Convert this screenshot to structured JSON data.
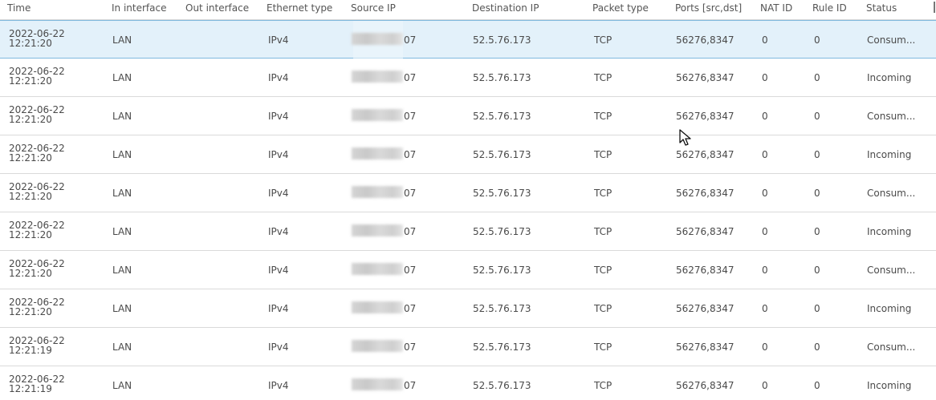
{
  "columns": {
    "time": "Time",
    "in_interface": "In interface",
    "out_interface": "Out interface",
    "ethernet_type": "Ethernet type",
    "source_ip": "Source IP",
    "destination_ip": "Destination IP",
    "packet_type": "Packet type",
    "ports": "Ports [src,dst]",
    "nat_id": "NAT ID",
    "rule_id": "Rule ID",
    "status": "Status"
  },
  "rows": [
    {
      "date": "2022-06-22",
      "clock": "12:21:20",
      "in": "LAN",
      "out": "",
      "eth": "IPv4",
      "src_tail": "07",
      "dst": "52.5.76.173",
      "ptype": "TCP",
      "ports": "56276,8347",
      "nat": "0",
      "rule": "0",
      "status": "Consum..."
    },
    {
      "date": "2022-06-22",
      "clock": "12:21:20",
      "in": "LAN",
      "out": "",
      "eth": "IPv4",
      "src_tail": "07",
      "dst": "52.5.76.173",
      "ptype": "TCP",
      "ports": "56276,8347",
      "nat": "0",
      "rule": "0",
      "status": "Incoming"
    },
    {
      "date": "2022-06-22",
      "clock": "12:21:20",
      "in": "LAN",
      "out": "",
      "eth": "IPv4",
      "src_tail": "07",
      "dst": "52.5.76.173",
      "ptype": "TCP",
      "ports": "56276,8347",
      "nat": "0",
      "rule": "0",
      "status": "Consum..."
    },
    {
      "date": "2022-06-22",
      "clock": "12:21:20",
      "in": "LAN",
      "out": "",
      "eth": "IPv4",
      "src_tail": "07",
      "dst": "52.5.76.173",
      "ptype": "TCP",
      "ports": "56276,8347",
      "nat": "0",
      "rule": "0",
      "status": "Incoming"
    },
    {
      "date": "2022-06-22",
      "clock": "12:21:20",
      "in": "LAN",
      "out": "",
      "eth": "IPv4",
      "src_tail": "07",
      "dst": "52.5.76.173",
      "ptype": "TCP",
      "ports": "56276,8347",
      "nat": "0",
      "rule": "0",
      "status": "Consum..."
    },
    {
      "date": "2022-06-22",
      "clock": "12:21:20",
      "in": "LAN",
      "out": "",
      "eth": "IPv4",
      "src_tail": "07",
      "dst": "52.5.76.173",
      "ptype": "TCP",
      "ports": "56276,8347",
      "nat": "0",
      "rule": "0",
      "status": "Incoming"
    },
    {
      "date": "2022-06-22",
      "clock": "12:21:20",
      "in": "LAN",
      "out": "",
      "eth": "IPv4",
      "src_tail": "07",
      "dst": "52.5.76.173",
      "ptype": "TCP",
      "ports": "56276,8347",
      "nat": "0",
      "rule": "0",
      "status": "Consum..."
    },
    {
      "date": "2022-06-22",
      "clock": "12:21:20",
      "in": "LAN",
      "out": "",
      "eth": "IPv4",
      "src_tail": "07",
      "dst": "52.5.76.173",
      "ptype": "TCP",
      "ports": "56276,8347",
      "nat": "0",
      "rule": "0",
      "status": "Incoming"
    },
    {
      "date": "2022-06-22",
      "clock": "12:21:19",
      "in": "LAN",
      "out": "",
      "eth": "IPv4",
      "src_tail": "07",
      "dst": "52.5.76.173",
      "ptype": "TCP",
      "ports": "56276,8347",
      "nat": "0",
      "rule": "0",
      "status": "Consum..."
    },
    {
      "date": "2022-06-22",
      "clock": "12:21:19",
      "in": "LAN",
      "out": "",
      "eth": "IPv4",
      "src_tail": "07",
      "dst": "52.5.76.173",
      "ptype": "TCP",
      "ports": "56276,8347",
      "nat": "0",
      "rule": "0",
      "status": "Incoming"
    }
  ],
  "selected_row": 0,
  "colors": {
    "selected_bg": "#e3f1fa",
    "selected_border": "#7fb9df",
    "row_divider": "#dadada",
    "text": "#4a4a4a"
  },
  "icons": {
    "cursor": "mouse-pointer-icon"
  }
}
